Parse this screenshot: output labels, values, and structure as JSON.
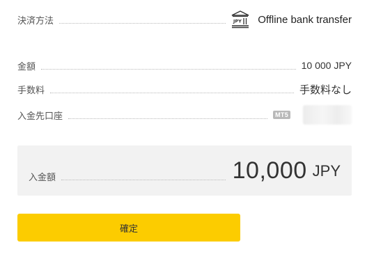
{
  "payment_method": {
    "label": "決済方法",
    "icon": "bank-icon",
    "icon_text": "JPY",
    "value": "Offline bank transfer"
  },
  "amount": {
    "label": "金額",
    "value": "10 000 JPY"
  },
  "fee": {
    "label": "手数料",
    "value": "手数料なし"
  },
  "deposit_account": {
    "label": "入金先口座",
    "badge": "MT5"
  },
  "total": {
    "label": "入金額",
    "amount": "10,000",
    "currency": "JPY"
  },
  "confirm_button": {
    "label": "確定",
    "color": "#fccc00"
  }
}
